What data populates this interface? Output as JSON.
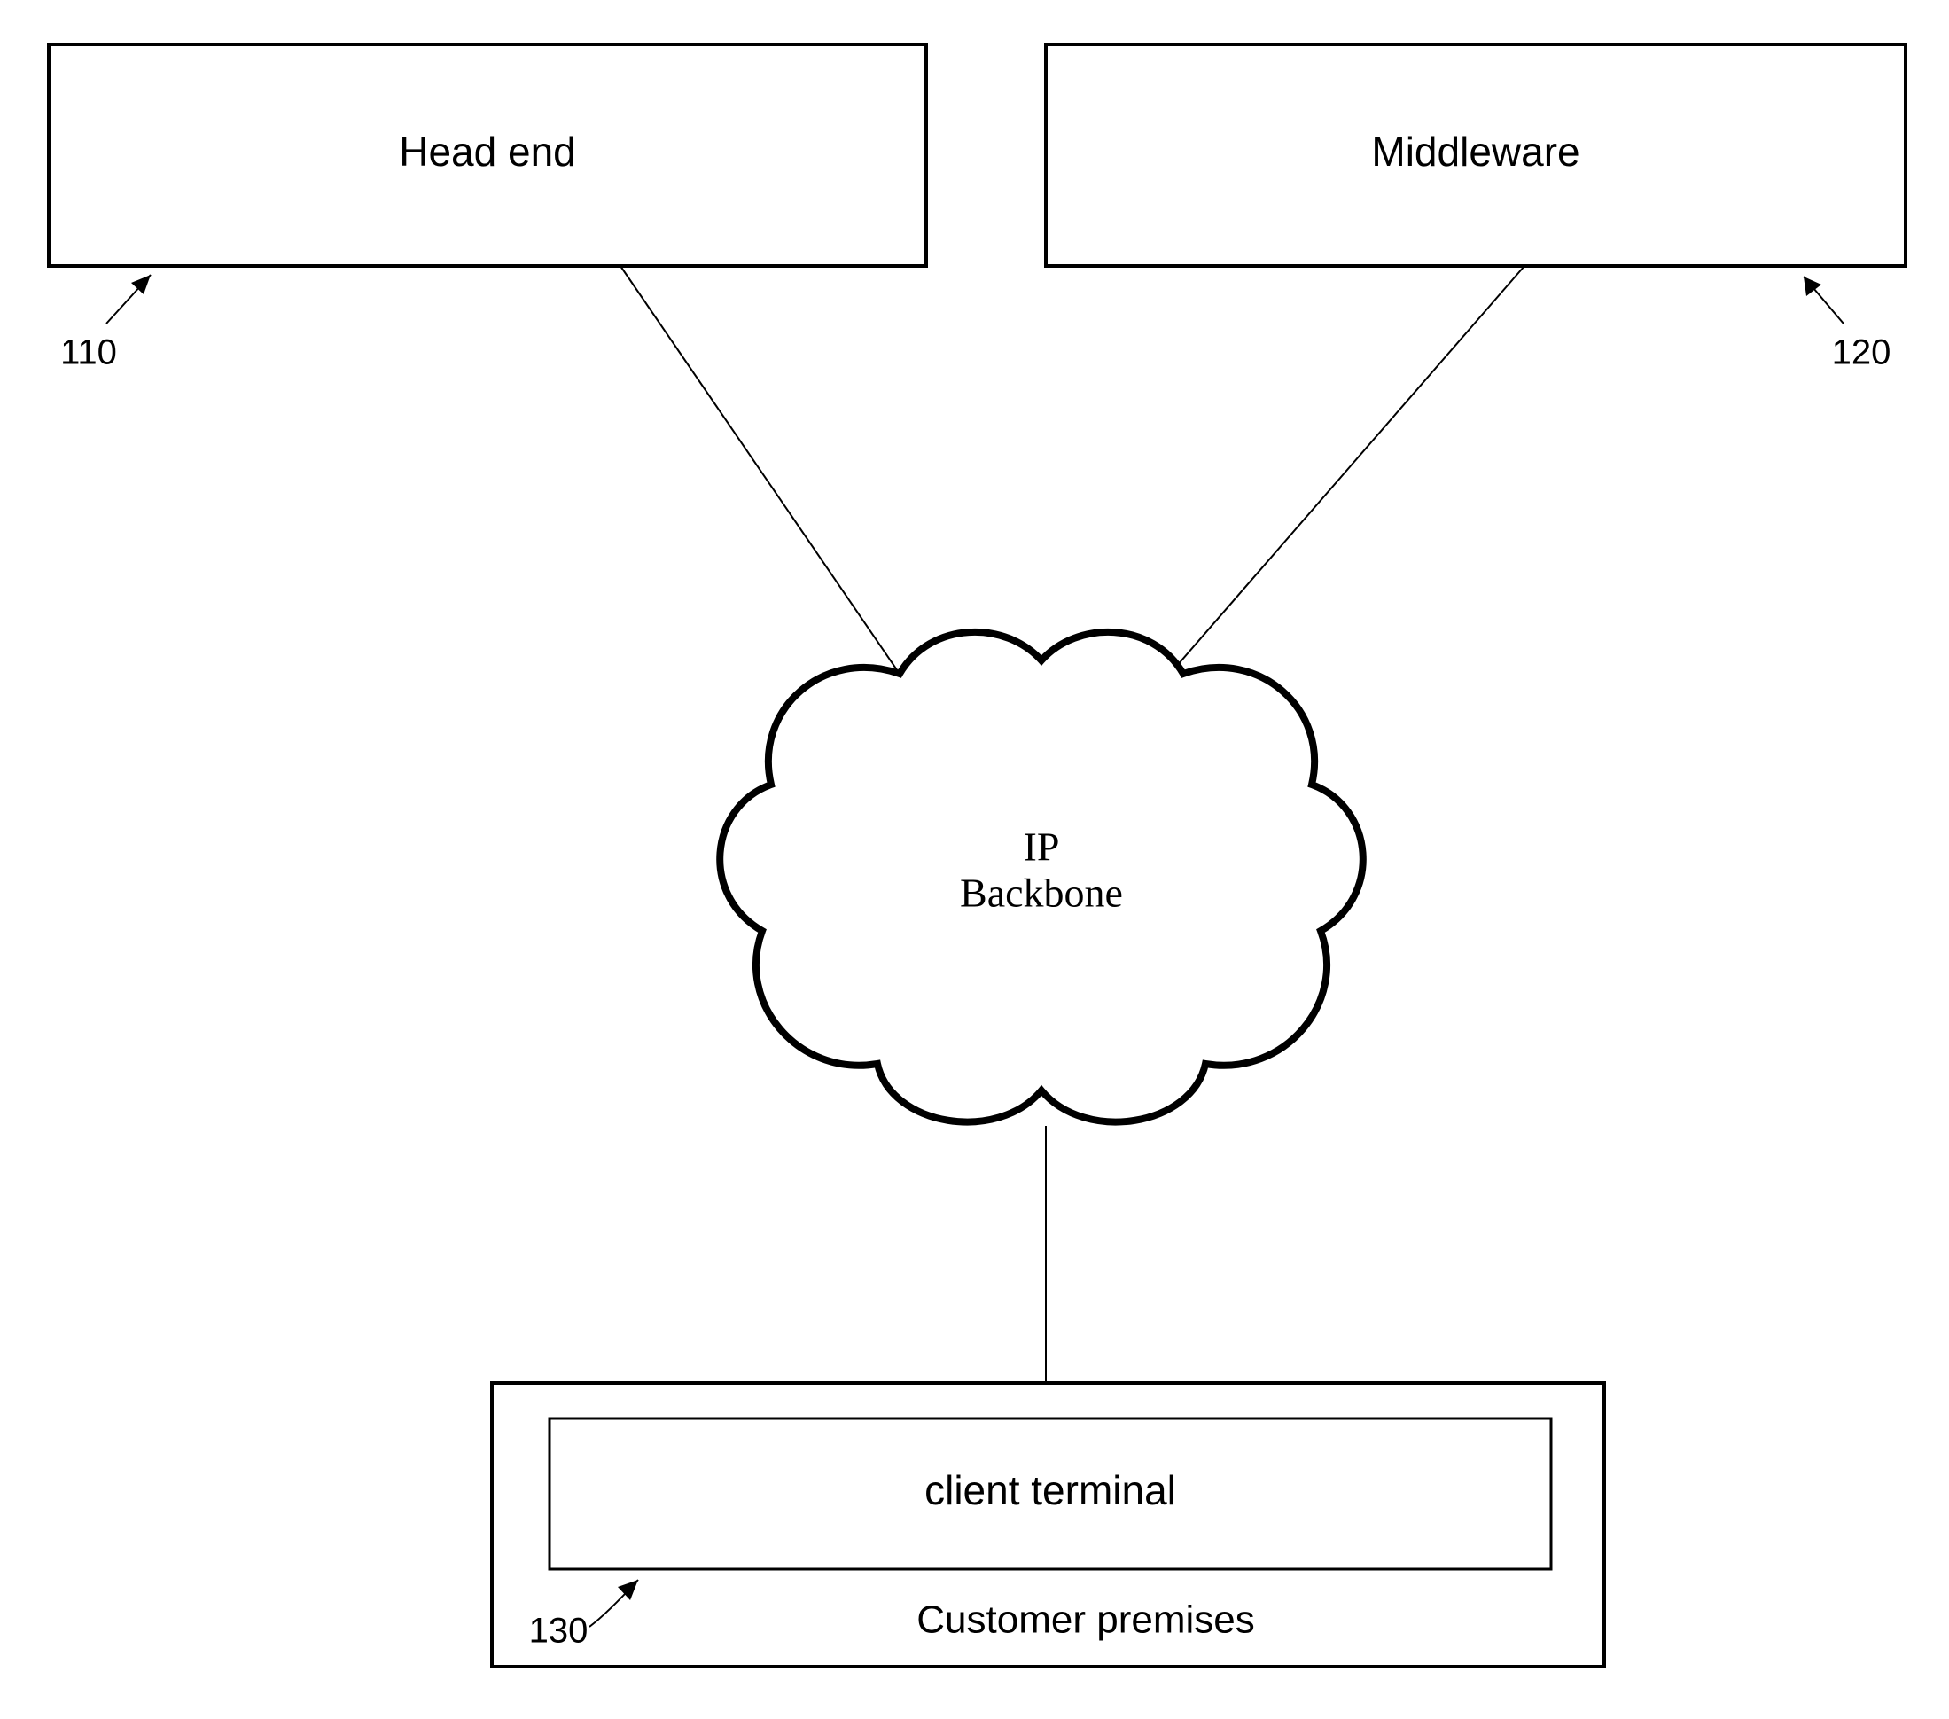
{
  "headend": {
    "label": "Head end",
    "ref": "110"
  },
  "middleware": {
    "label": "Middleware",
    "ref": "120"
  },
  "cloud": {
    "line1": "IP",
    "line2": "Backbone"
  },
  "premises": {
    "label": "Customer premises"
  },
  "client": {
    "label": "client terminal",
    "ref": "130"
  }
}
